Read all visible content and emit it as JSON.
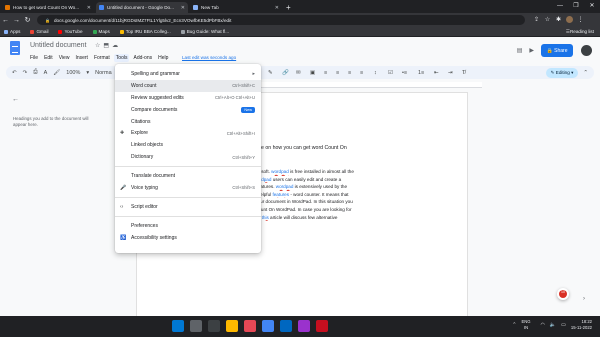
{
  "browser": {
    "tabs": [
      {
        "label": "How to get word Count On Wo...",
        "color": "#e37400"
      },
      {
        "label": "Untitled document - Google Do...",
        "color": "#4285f4"
      },
      {
        "label": "New Tab",
        "color": "#8ab4f8"
      }
    ],
    "url": "docs.google.com/document/d/11bjRGDsIMZ7FtL1Ylg5lv2_Ecn3VOwfbKE5dPbFBx/edit",
    "bookmarks": [
      {
        "label": "Apps",
        "color": "#8ab4f8"
      },
      {
        "label": "Gmail",
        "color": "#ea4335"
      },
      {
        "label": "YouTube",
        "color": "#ff0000"
      },
      {
        "label": "Maps",
        "color": "#34a853"
      },
      {
        "label": "Top IRU BBA Colleg...",
        "color": "#fbbc04"
      },
      {
        "label": "Bug Guide: What fl...",
        "color": "#9aa0a6"
      }
    ],
    "reading_list": "Reading list"
  },
  "docs": {
    "title": "Untitled document",
    "menus": [
      "File",
      "Edit",
      "View",
      "Insert",
      "Format",
      "Tools",
      "Add-ons",
      "Help"
    ],
    "last_edit": "Last edit was seconds ago",
    "share_label": "Share",
    "toolbar": {
      "zoom": "100%",
      "style": "Norma",
      "mode": "Editing"
    }
  },
  "outline": {
    "text": "Headings you add to the document will appear here."
  },
  "document": {
    "heading": "step guide on how you can get word Count On",
    "lines": [
      {
        "pre": "d by Microsoft. ",
        "sp": "wordpad",
        "post": " is free installed in almost all the"
      },
      {
        "pre": "ms. In ",
        "sp": "wordpad",
        "post": " users can easily edit and create a"
      },
      {
        "pre": "rmation features. ",
        "sp": "wordpad",
        "post": " is extensively used by the"
      },
      {
        "pre": "e a very helpful ",
        "sp": "features",
        "post": " - word counter. It means that"
      },
      {
        "pre": "ords of your document in WordPad. In this situation you",
        "sp": "",
        "post": ""
      },
      {
        "pre": "n word Count On WordPad. In case you are looking for",
        "sp": "",
        "post": ""
      },
      {
        "pre": "WordPad, ",
        "sp": "this",
        "post": " article will discuss few alternative"
      }
    ]
  },
  "tools_menu": {
    "items": [
      {
        "label": "Spelling and grammar",
        "shortcut": "",
        "arrow": true
      },
      {
        "label": "Word count",
        "shortcut": "Ctrl+Shift+C",
        "highlight": true
      },
      {
        "label": "Review suggested edits",
        "shortcut": "Ctrl+Alt+O Ctrl+Alt+U"
      },
      {
        "label": "Compare documents",
        "badge": "New"
      },
      {
        "label": "Citations"
      },
      {
        "label": "Explore",
        "shortcut": "Ctrl+Alt+Shift+I",
        "icon": "✚"
      },
      {
        "label": "Linked objects"
      },
      {
        "label": "Dictionary",
        "shortcut": "Ctrl+Shift+Y"
      },
      {
        "sep": true
      },
      {
        "label": "Translate document"
      },
      {
        "label": "Voice typing",
        "shortcut": "Ctrl+Shift+S",
        "icon": "🎤"
      },
      {
        "sep": true
      },
      {
        "label": "Script editor",
        "icon": "‹›"
      },
      {
        "sep": true
      },
      {
        "label": "Preferences"
      },
      {
        "label": "Accessibility settings",
        "icon": "♿"
      }
    ]
  },
  "explore_badge": "10",
  "taskbar": {
    "icons": [
      "#0078d4",
      "#ffffff",
      "#3c4043",
      "#ffb900",
      "#e74856",
      "#4285f4",
      "#0067c0",
      "#9a32cd",
      "#c50f1f"
    ],
    "lang_top": "ENG",
    "lang_bottom": "IN",
    "time": "18:22",
    "date": "15-11-2022"
  }
}
